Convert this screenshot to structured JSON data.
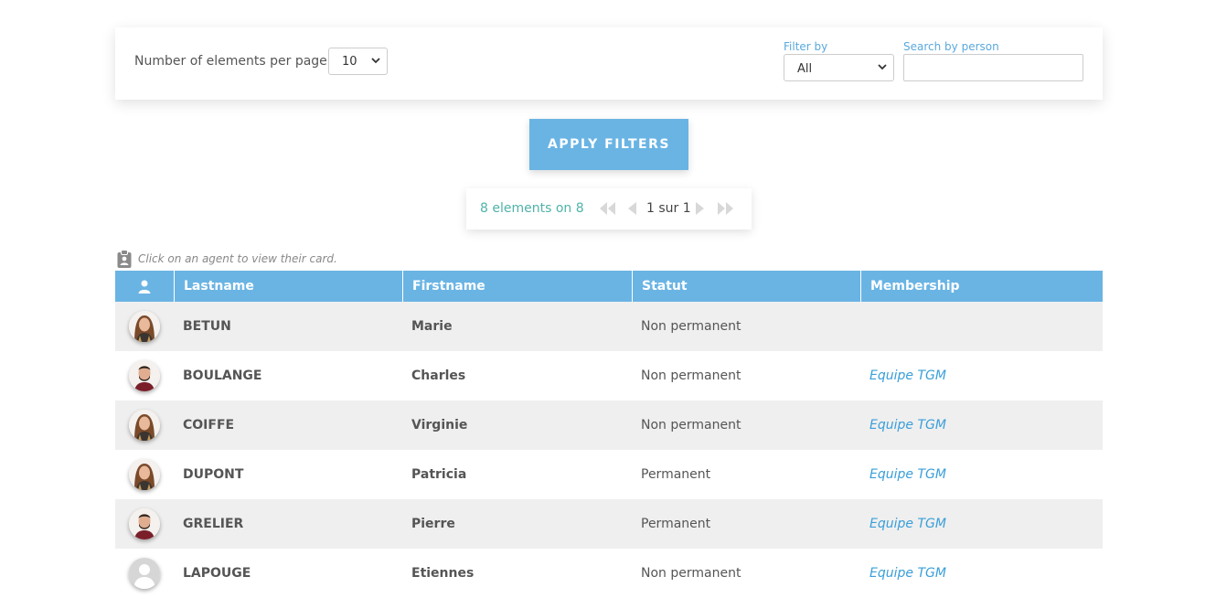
{
  "filters": {
    "per_page_label": "Number of elements per page:",
    "per_page_value": "10",
    "filter_by_label": "Filter by",
    "filter_by_value": "All",
    "search_label": "Search by person",
    "search_value": ""
  },
  "apply_button": "APPLY FILTERS",
  "pager": {
    "count_text": "8 elements on 8",
    "page_text": "1 sur 1"
  },
  "hint": "Click on an agent to view their card.",
  "colors": {
    "header_bg": "#6ab4e4",
    "accent_link": "#3a9fd9",
    "count_text": "#4fb3a9"
  },
  "table": {
    "columns": [
      "Lastname",
      "Firstname",
      "Statut",
      "Membership"
    ],
    "rows": [
      {
        "avatar": "woman",
        "lastname": "BETUN",
        "firstname": "Marie",
        "statut": "Non permanent",
        "membership": ""
      },
      {
        "avatar": "man",
        "lastname": "BOULANGE",
        "firstname": "Charles",
        "statut": "Non permanent",
        "membership": "Equipe TGM"
      },
      {
        "avatar": "woman",
        "lastname": "COIFFE",
        "firstname": "Virginie",
        "statut": "Non permanent",
        "membership": "Equipe TGM"
      },
      {
        "avatar": "woman",
        "lastname": "DUPONT",
        "firstname": "Patricia",
        "statut": "Permanent",
        "membership": "Equipe TGM"
      },
      {
        "avatar": "man",
        "lastname": "GRELIER",
        "firstname": "Pierre",
        "statut": "Permanent",
        "membership": "Equipe TGM"
      },
      {
        "avatar": "placeholder",
        "lastname": "LAPOUGE",
        "firstname": "Etiennes",
        "statut": "Non permanent",
        "membership": "Equipe TGM"
      }
    ]
  }
}
